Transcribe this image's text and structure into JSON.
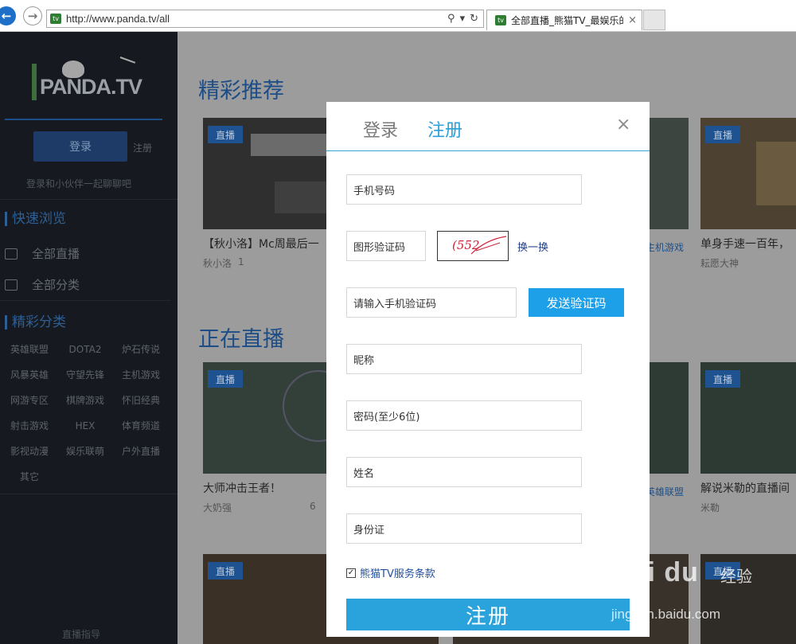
{
  "browser": {
    "url": "http://www.panda.tv/all",
    "tab_title": "全部直播_熊猫TV_最娱乐的..."
  },
  "sidebar": {
    "logo_text": "PANDA.TV",
    "login_label": "登录",
    "register_label": "注册",
    "tip": "登录和小伙伴一起聊聊吧",
    "quick_browse_title": "快速浏览",
    "quick_items": [
      {
        "label": "全部直播",
        "icon": "tv-icon"
      },
      {
        "label": "全部分类",
        "icon": "grid-icon"
      }
    ],
    "categories_title": "精彩分类",
    "categories": [
      "英雄联盟",
      "DOTA2",
      "炉石传说",
      "风暴英雄",
      "守望先锋",
      "主机游戏",
      "网游专区",
      "棋牌游戏",
      "怀旧经典",
      "射击游戏",
      "HEX",
      "体育频道",
      "影视动漫",
      "娱乐联萌",
      "户外直播",
      "其它"
    ],
    "footer": "直播指导"
  },
  "main": {
    "recommend_title": "精彩推荐",
    "live_title": "正在直播",
    "live_tag": "直播",
    "cards": [
      {
        "title": "【秋小洛】Mc周最后一",
        "streamer": "秋小洛",
        "viewers": "1",
        "category": ""
      },
      {
        "title": "",
        "streamer": "",
        "viewers": "",
        "category": "主机游戏"
      },
      {
        "title": "单身手速一百年，",
        "streamer": "耘愿大神",
        "viewers": "",
        "category": ""
      },
      {
        "title": "大师冲击王者！",
        "streamer": "大奶强",
        "viewers": "6",
        "category": ""
      },
      {
        "title": "",
        "streamer": "",
        "viewers": "",
        "category": "英雄联盟"
      },
      {
        "title": "解说米勒的直播间",
        "streamer": "米勒",
        "viewers": "",
        "category": ""
      }
    ]
  },
  "modal": {
    "tab_login": "登录",
    "tab_register": "注册",
    "close_glyph": "×",
    "phone_placeholder": "手机号码",
    "captcha_placeholder": "图形验证码",
    "captcha_text": "(552",
    "captcha_refresh": "换一换",
    "sms_placeholder": "请输入手机验证码",
    "send_code": "发送验证码",
    "nickname_placeholder": "昵称",
    "password_placeholder": "密码(至少6位)",
    "name_placeholder": "姓名",
    "id_placeholder": "身份证",
    "agree_checked": true,
    "agree_text": "熊猫TV服务条款",
    "submit": "注册"
  },
  "watermark": {
    "brand": "Bai du",
    "label": "经验",
    "url": "jingyan.baidu.com"
  },
  "colors": {
    "accent": "#2aa3dc",
    "send_button": "#1ea0e8",
    "sidebar_bg": "#161a20",
    "live_tag": "#1e5290"
  }
}
